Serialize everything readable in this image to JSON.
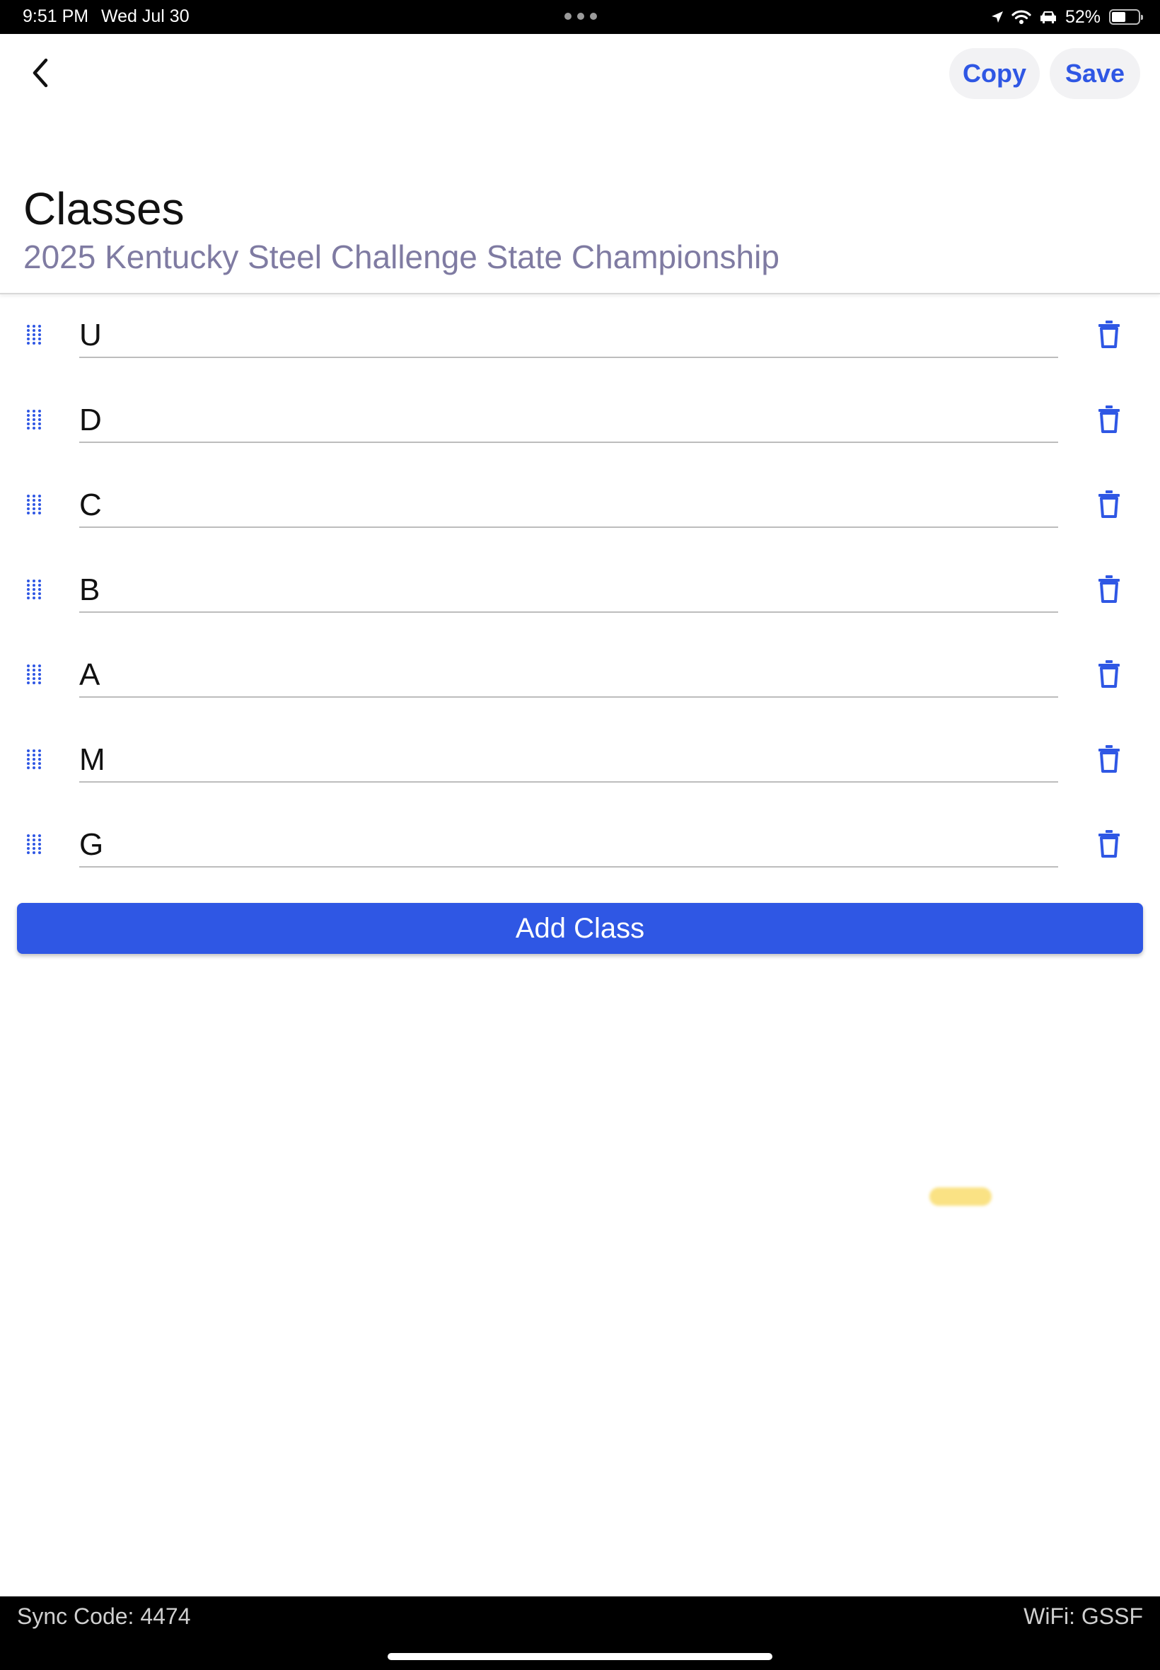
{
  "status_bar": {
    "time": "9:51 PM",
    "date": "Wed Jul 30",
    "battery_percent": "52%",
    "battery_level": 0.52,
    "icons": [
      "location-icon",
      "wifi-icon",
      "car-icon",
      "battery-icon"
    ]
  },
  "nav": {
    "back_icon": "chevron-left-icon",
    "copy_label": "Copy",
    "save_label": "Save"
  },
  "header": {
    "title": "Classes",
    "subtitle": "2025 Kentucky Steel Challenge State Championship"
  },
  "classes": [
    {
      "name": "U"
    },
    {
      "name": "D"
    },
    {
      "name": "C"
    },
    {
      "name": "B"
    },
    {
      "name": "A"
    },
    {
      "name": "M"
    },
    {
      "name": "G"
    }
  ],
  "add_button_label": "Add Class",
  "footer": {
    "sync_code": "Sync Code: 4474",
    "wifi": "WiFi: GSSF"
  },
  "colors": {
    "accent": "#2f57e4",
    "subtitle": "#7f7ba2",
    "status_bar": "#000000"
  }
}
